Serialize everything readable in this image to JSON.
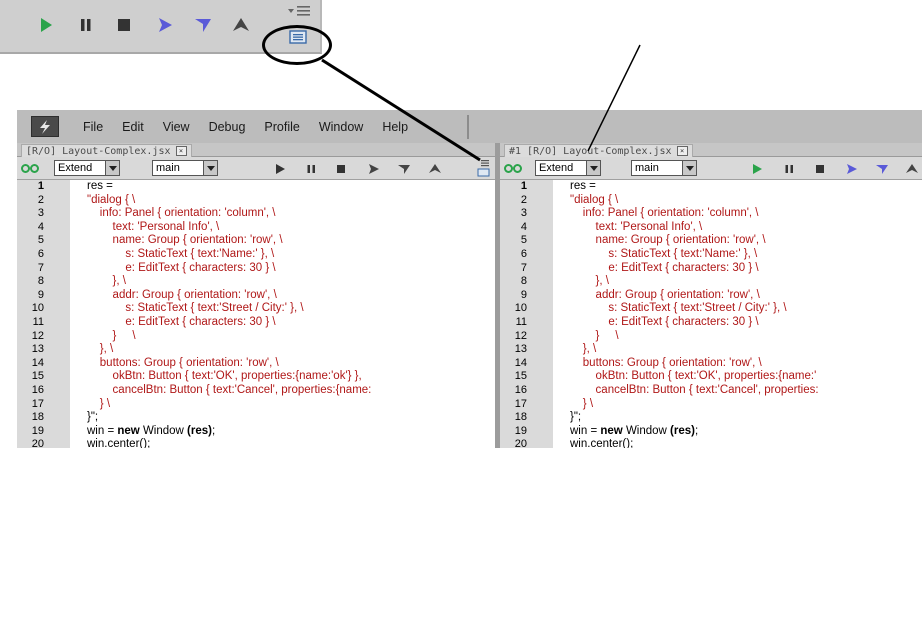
{
  "inset_toolbar": {
    "buttons": [
      {
        "name": "run-icon",
        "color": "#2aa34a"
      },
      {
        "name": "pause-icon",
        "color": "#333333"
      },
      {
        "name": "stop-icon",
        "color": "#333333"
      },
      {
        "name": "step-over-icon",
        "color": "#5a5ad8"
      },
      {
        "name": "step-into-icon",
        "color": "#5a5ad8"
      },
      {
        "name": "step-out-icon",
        "color": "#444444"
      }
    ]
  },
  "menubar": {
    "items": [
      "File",
      "Edit",
      "View",
      "Debug",
      "Profile",
      "Window",
      "Help"
    ]
  },
  "left_pane": {
    "tab_title": "[R/O] Layout-Complex.jsx",
    "tab_close": "×",
    "mode_select": "Extend",
    "target_select": "main"
  },
  "right_pane": {
    "tab_title": "#1 [R/O] Layout-Complex.jsx",
    "tab_close": "×",
    "mode_select": "Extend",
    "target_select": "main"
  },
  "line_numbers": [
    "1",
    "2",
    "3",
    "4",
    "5",
    "6",
    "7",
    "8",
    "9",
    "10",
    "11",
    "12",
    "13",
    "14",
    "15",
    "16",
    "17",
    "18",
    "19",
    "20"
  ],
  "code_left": [
    "res =",
    "\"dialog { \\",
    "    info: Panel { orientation: 'column', \\",
    "        text: 'Personal Info', \\",
    "        name: Group { orientation: 'row', \\",
    "            s: StaticText { text:'Name:' }, \\",
    "            e: EditText { characters: 30 } \\",
    "        }, \\",
    "        addr: Group { orientation: 'row', \\",
    "            s: StaticText { text:'Street / City:' }, \\",
    "            e: EditText { characters: 30 } \\",
    "        }     \\",
    "    }, \\",
    "    buttons: Group { orientation: 'row', \\",
    "        okBtn: Button { text:'OK', properties:{name:'ok'} },",
    "        cancelBtn: Button { text:'Cancel', properties:{name:",
    "    } \\",
    "}\";",
    "win = new Window (res);",
    "win.center();"
  ],
  "code_right": [
    "res =",
    "\"dialog { \\",
    "    info: Panel { orientation: 'column', \\",
    "        text: 'Personal Info', \\",
    "        name: Group { orientation: 'row', \\",
    "            s: StaticText { text:'Name:' }, \\",
    "            e: EditText { characters: 30 } \\",
    "        }, \\",
    "        addr: Group { orientation: 'row', \\",
    "            s: StaticText { text:'Street / City:' }, \\",
    "            e: EditText { characters: 30 } \\",
    "        }     \\",
    "    }, \\",
    "    buttons: Group { orientation: 'row', \\",
    "        okBtn: Button { text:'OK', properties:{name:'",
    "        cancelBtn: Button { text:'Cancel', properties:",
    "    } \\",
    "}\";",
    "win = new Window (res);",
    "win.center();"
  ],
  "colors": {
    "code_text": "#b01818",
    "keyword_text": "#000000",
    "gutter": "#dadada",
    "run_green": "#2aa34a",
    "step_blue": "#5a5ad8"
  }
}
